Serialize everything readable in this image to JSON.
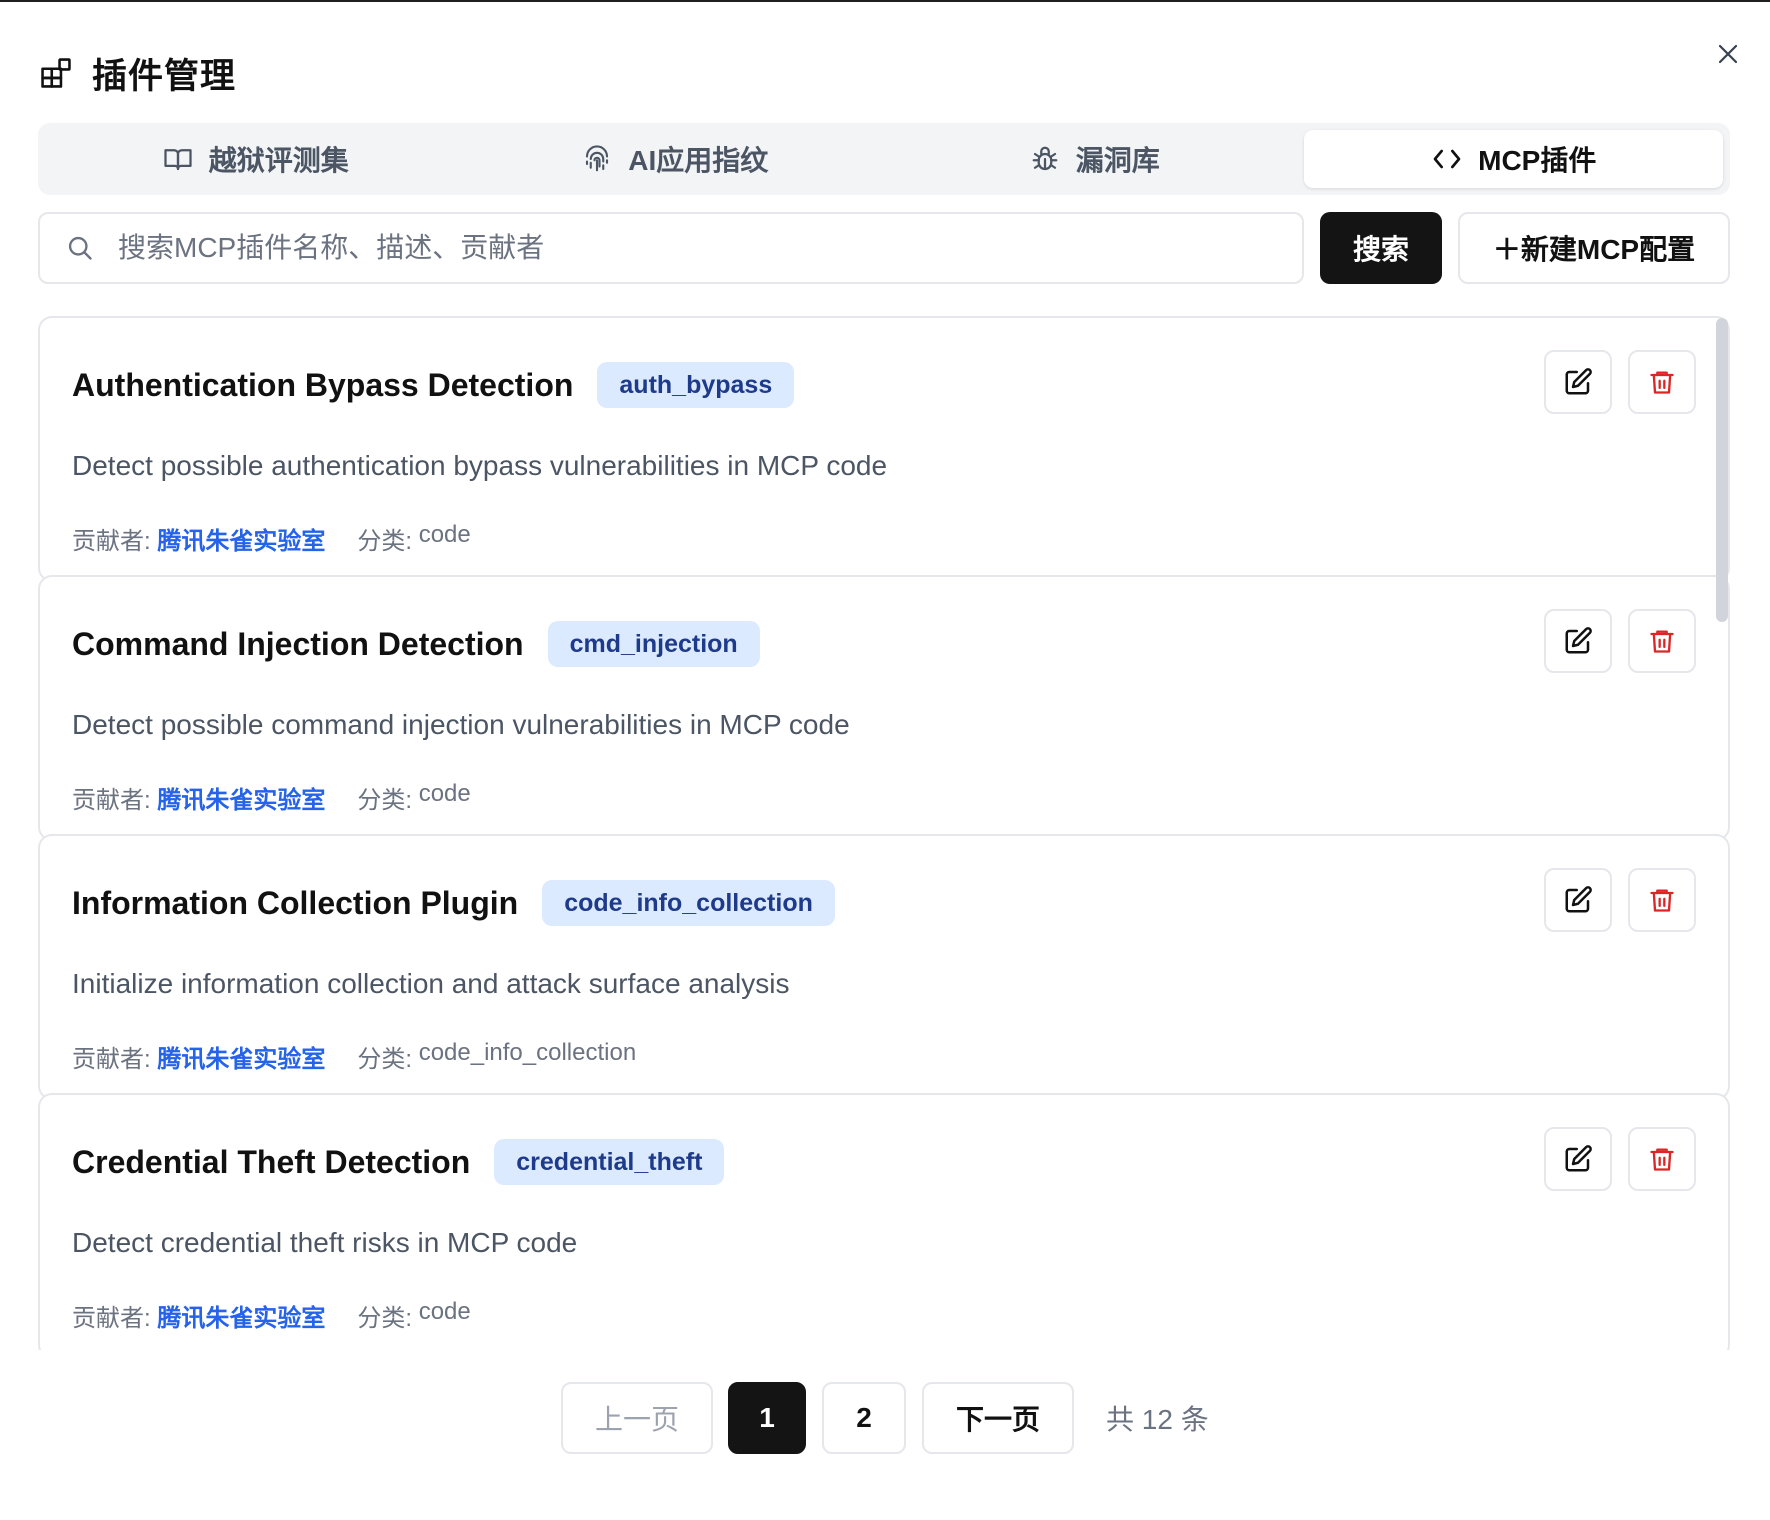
{
  "dialog": {
    "title": "插件管理",
    "close_icon": "close-icon"
  },
  "tabs": [
    {
      "label": "越狱评测集",
      "icon": "book-icon",
      "active": false
    },
    {
      "label": "AI应用指纹",
      "icon": "fingerprint-icon",
      "active": false
    },
    {
      "label": "漏洞库",
      "icon": "bug-icon",
      "active": false
    },
    {
      "label": "MCP插件",
      "icon": "code-icon",
      "active": true
    }
  ],
  "search": {
    "placeholder": "搜索MCP插件名称、描述、贡献者",
    "value": "",
    "button_label": "搜索"
  },
  "new_button_label": "＋新建MCP配置",
  "meta_labels": {
    "contributor": "贡献者:",
    "category": "分类:"
  },
  "plugins": [
    {
      "name": "Authentication Bypass Detection",
      "tag": "auth_bypass",
      "description": "Detect possible authentication bypass vulnerabilities in MCP code",
      "contributor": "腾讯朱雀实验室",
      "category": "code"
    },
    {
      "name": "Command Injection Detection",
      "tag": "cmd_injection",
      "description": "Detect possible command injection vulnerabilities in MCP code",
      "contributor": "腾讯朱雀实验室",
      "category": "code"
    },
    {
      "name": "Information Collection Plugin",
      "tag": "code_info_collection",
      "description": "Initialize information collection and attack surface analysis",
      "contributor": "腾讯朱雀实验室",
      "category": "code_info_collection"
    },
    {
      "name": "Credential Theft Detection",
      "tag": "credential_theft",
      "description": "Detect credential theft risks in MCP code",
      "contributor": "腾讯朱雀实验室",
      "category": "code"
    }
  ],
  "pagination": {
    "prev_label": "上一页",
    "next_label": "下一页",
    "pages": [
      "1",
      "2"
    ],
    "current_page": "1",
    "total_label": "共 12 条"
  },
  "colors": {
    "accent_dark": "#141414",
    "link_blue": "#2563eb",
    "tag_bg": "#dbeafe",
    "tag_text": "#1e3a8a",
    "delete_red": "#dc2626"
  }
}
